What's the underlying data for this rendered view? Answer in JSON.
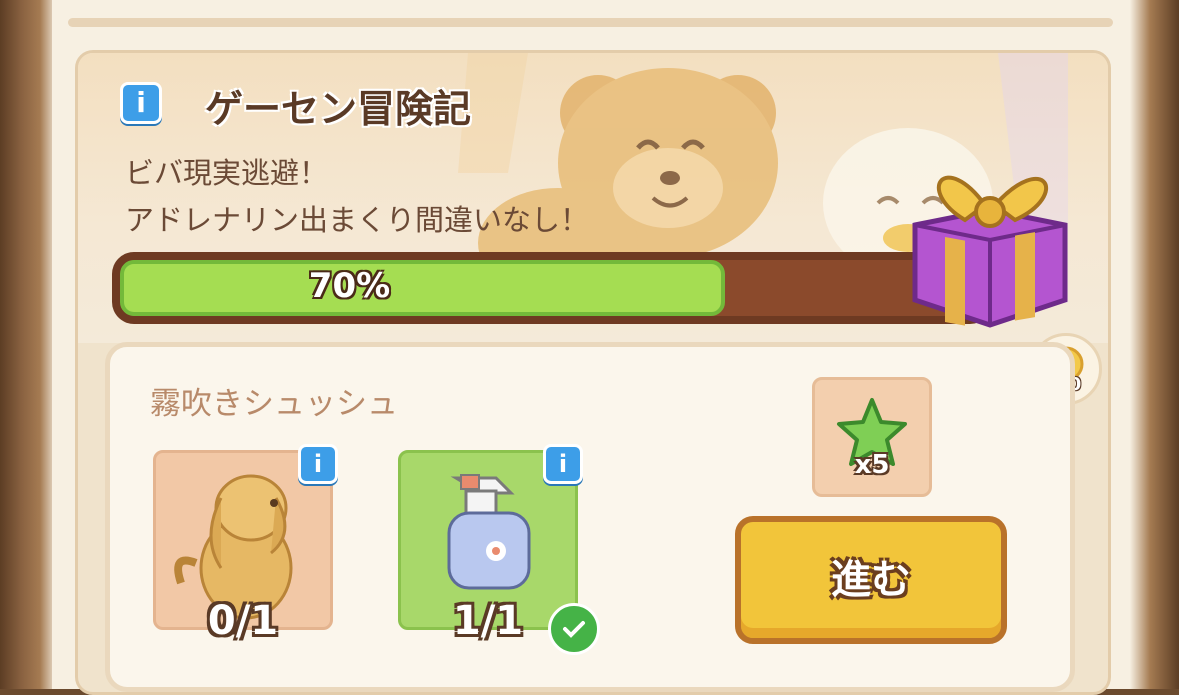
{
  "quest": {
    "title": "ゲーセン冒険記",
    "description_line1": "ビバ現実逃避！",
    "description_line2": "アドレナリン出まくり間違いなし！",
    "progress_percent": 70,
    "progress_label": "70%",
    "gift_reward_count": "x80"
  },
  "task": {
    "title": "霧吹きシュッシュ",
    "requirements": [
      {
        "name": "dog-item",
        "icon": "dog-icon",
        "count_label": "0/1",
        "completed": false
      },
      {
        "name": "spray-bottle-item",
        "icon": "spray-bottle-icon",
        "count_label": "1/1",
        "completed": true
      }
    ],
    "reward": {
      "icon": "green-star-icon",
      "count_label": "x5"
    },
    "go_button_label": "進む"
  },
  "colors": {
    "progress_fill": "#a5dd52",
    "progress_track": "#8b4a2c",
    "button": "#f2c53a",
    "info": "#3d9ee8"
  }
}
